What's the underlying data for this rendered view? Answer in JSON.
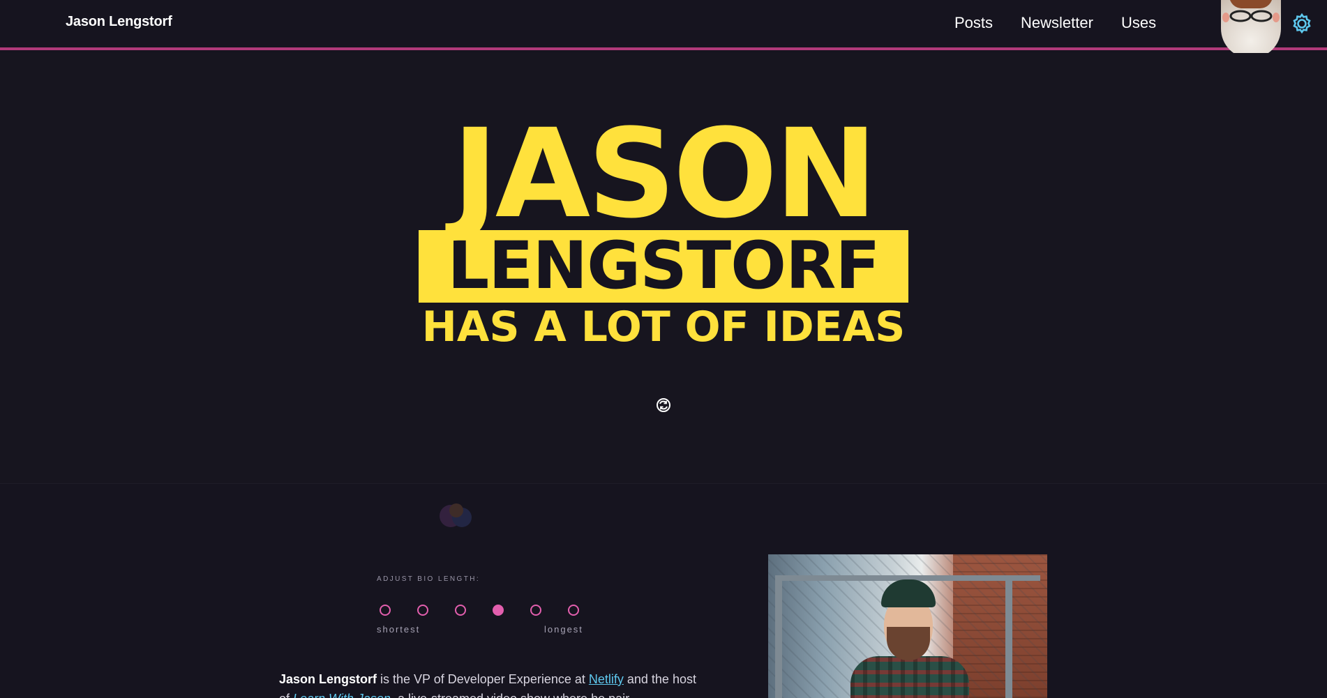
{
  "header": {
    "brand": "Jason Lengstorf",
    "nav": [
      {
        "label": "Posts"
      },
      {
        "label": "Newsletter"
      },
      {
        "label": "Uses"
      }
    ],
    "accent_color": "#b13a7a"
  },
  "hero": {
    "line1": "JASON",
    "line2": "LENGSTORF",
    "line3": "HAS A LOT OF IDEAS",
    "color": "#ffe13c"
  },
  "bio": {
    "adjust_label": "ADJUST BIO LENGTH:",
    "scale_min": "shortest",
    "scale_max": "longest",
    "selected_index": 3,
    "options_count": 6,
    "text": {
      "name": "Jason Lengstorf",
      "part1": " is the VP of Developer Experience at ",
      "link1": "Netlify",
      "part2": " and the host of ",
      "link2": "Learn With Jason",
      "part3": ", a live-streamed video show where he pair"
    },
    "radio_color": "#e35fae"
  }
}
